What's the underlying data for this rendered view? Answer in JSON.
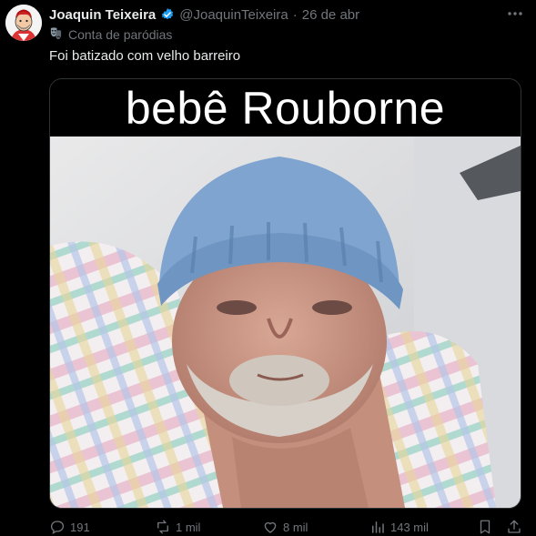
{
  "author": {
    "name": "Joaquin Teixeira",
    "handle": "@JoaquinTeixeira",
    "separator": "·",
    "date": "26 de abr",
    "verified_color": "#1d9bf0"
  },
  "parody_label": "Conta de paródias",
  "tweet_text": "Foi batizado com velho barreiro",
  "media": {
    "caption": "bebê Rouborne",
    "description_icon": "baby-photo"
  },
  "actions": {
    "replies": "191",
    "retweets": "1 mil",
    "likes": "8 mil",
    "views": "143 mil"
  },
  "colors": {
    "background": "#000000",
    "text": "#e7e9ea",
    "muted": "#71767b",
    "accent": "#1d9bf0"
  }
}
